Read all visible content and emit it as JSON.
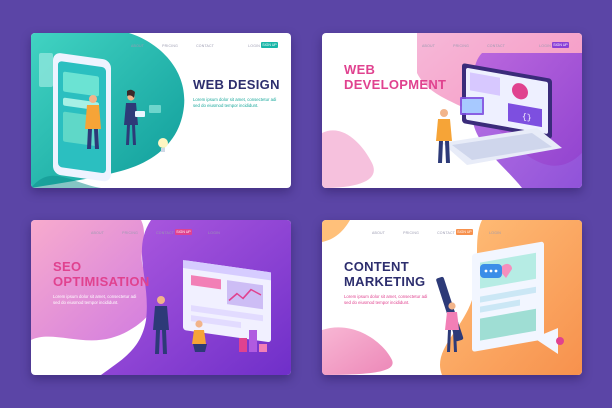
{
  "cards": [
    {
      "title": "WEB DESIGN",
      "nav": [
        "ABOUT",
        "PRICING",
        "CONTACT",
        "LOGIN"
      ],
      "signup": "SIGN UP",
      "desc_line1": "Lorem ipsum dolor sit amet, consectetur adi",
      "desc_line2": "sed do eiusmod tempor incididunt."
    },
    {
      "title_line1": "WEB",
      "title_line2": "DEVELOPMENT",
      "nav": [
        "ABOUT",
        "PRICING",
        "CONTACT",
        "LOGIN"
      ],
      "signup": "SIGN UP",
      "desc_line1": "Lorem ipsum dolor sit amet, consectetur adi",
      "desc_line2": "sed do eiusmod tempor incididunt."
    },
    {
      "title_line1": "SEO",
      "title_line2": "OPTIMISATION",
      "nav": [
        "ABOUT",
        "PRICING",
        "CONTACT",
        "LOGIN"
      ],
      "signup": "SIGN UP",
      "desc_line1": "Lorem ipsum dolor sit amet, consectetur adi",
      "desc_line2": "sed do eiusmod tempor incididunt."
    },
    {
      "title_line1": "CONTENT",
      "title_line2": "MARKETING",
      "nav": [
        "ABOUT",
        "PRICING",
        "CONTACT",
        "LOGIN"
      ],
      "signup": "SIGN UP",
      "desc_line1": "Lorem ipsum dolor sit amet, consectetur adi",
      "desc_line2": "sed do eiusmod tempor incididunt."
    }
  ],
  "colors": {
    "background": "#5b45a6",
    "title_dark": "#2d2e6e",
    "title_pink": "#e0428f",
    "teal": "#19b6a8",
    "purple": "#8b3fd6",
    "pink": "#f27fb6",
    "orange": "#f7914d"
  }
}
